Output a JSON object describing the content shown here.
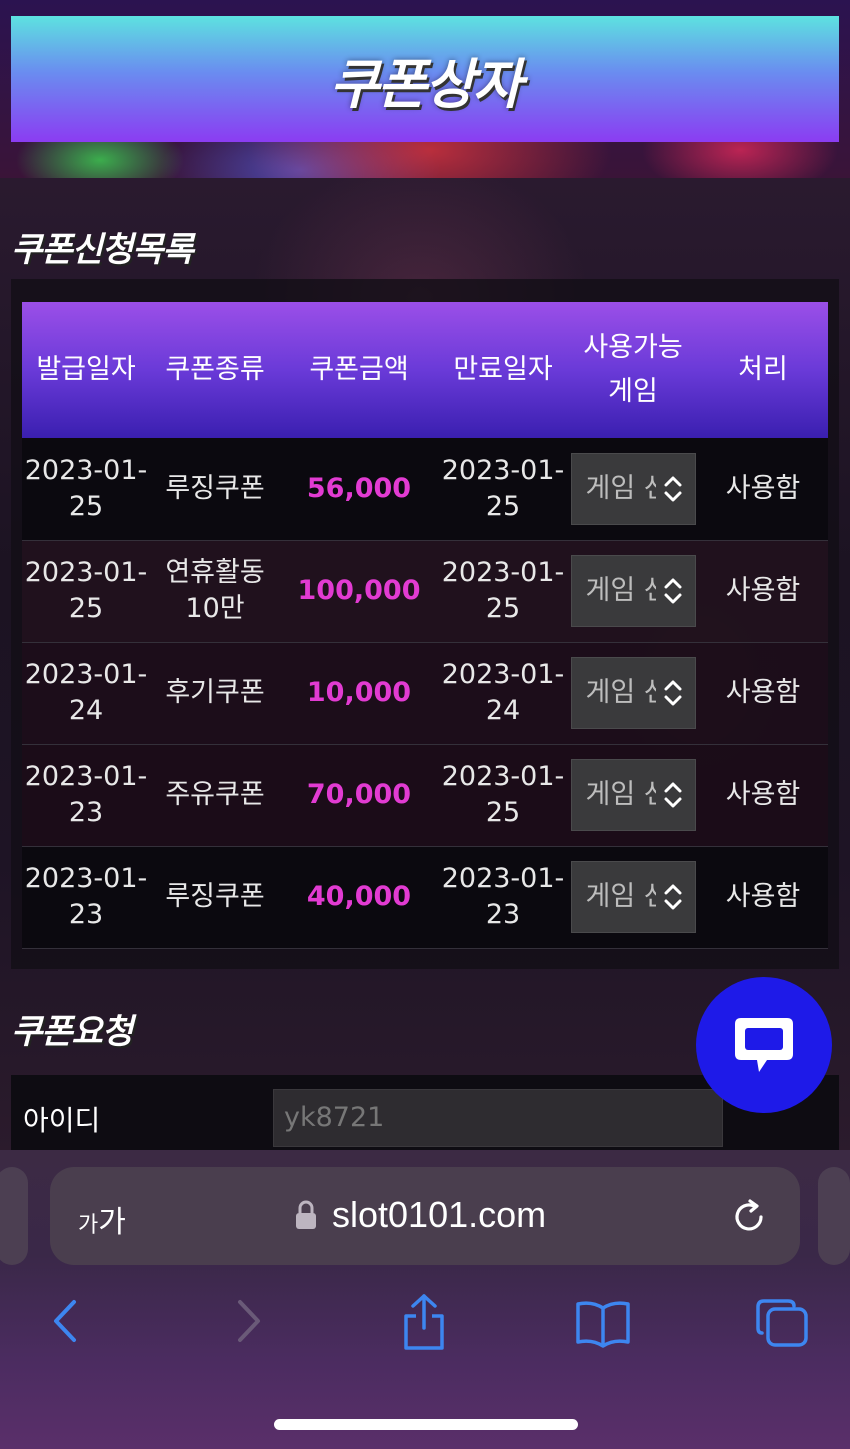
{
  "banner": {
    "title": "쿠폰상자"
  },
  "coupon_list": {
    "title": "쿠폰신청목록",
    "columns": [
      "발급일자",
      "쿠폰종류",
      "쿠폰금액",
      "만료일자",
      "사용가능\n게임",
      "처리"
    ],
    "rows": [
      {
        "issued": "2023-01-\n25",
        "type": "루징쿠폰",
        "amount": "56,000",
        "expires": "2023-01-\n25",
        "game": "게임 선",
        "action": "사용함"
      },
      {
        "issued": "2023-01-\n25",
        "type": "연휴활동\n10만",
        "amount": "100,000",
        "expires": "2023-01-\n25",
        "game": "게임 선",
        "action": "사용함"
      },
      {
        "issued": "2023-01-\n24",
        "type": "후기쿠폰",
        "amount": "10,000",
        "expires": "2023-01-\n24",
        "game": "게임 선",
        "action": "사용함"
      },
      {
        "issued": "2023-01-\n23",
        "type": "주유쿠폰",
        "amount": "70,000",
        "expires": "2023-01-\n25",
        "game": "게임 선",
        "action": "사용함"
      },
      {
        "issued": "2023-01-\n23",
        "type": "루징쿠폰",
        "amount": "40,000",
        "expires": "2023-01-\n23",
        "game": "게임 선",
        "action": "사용함"
      }
    ]
  },
  "request": {
    "title": "쿠폰요청",
    "id_label": "아이디",
    "id_value": "yk8721"
  },
  "browser": {
    "text_size_small": "가",
    "text_size_large": "가",
    "domain": "slot0101.com"
  },
  "colors": {
    "amount": "#e23bd2",
    "chat_button": "#1e1ae8",
    "toolbar_icon": "#3d86f0"
  },
  "icons": {
    "chat": "chat-bubble-icon",
    "lock": "lock-icon",
    "reload": "reload-icon",
    "back": "back-arrow-icon",
    "forward": "forward-arrow-icon",
    "share": "share-icon",
    "bookmarks": "bookmarks-icon",
    "tabs": "tabs-icon"
  }
}
